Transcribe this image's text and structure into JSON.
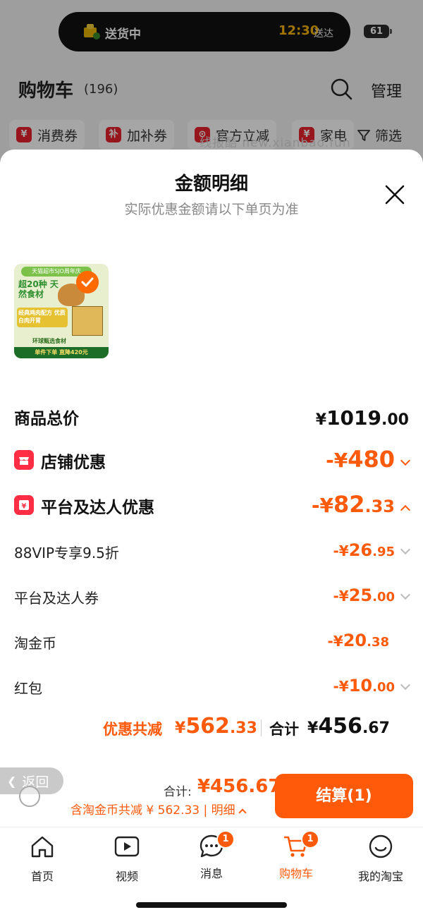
{
  "status": {
    "island_text": "送货中",
    "time": "12:30",
    "time_suffix": "送达",
    "battery": "61"
  },
  "cart": {
    "title": "购物车",
    "count": "(196)",
    "manage": "管理"
  },
  "chips": [
    {
      "icon": "¥",
      "label": "消费券"
    },
    {
      "icon": "补",
      "label": "加补券"
    },
    {
      "icon": "⊙",
      "label": "官方立减"
    },
    {
      "icon": "¥",
      "label": "家电"
    }
  ],
  "filter_label": "筛选",
  "watermark": "线报酷 new.xianbao.fun",
  "sheet": {
    "title": "金额明细",
    "subtitle": "实际优惠金额请以下单页为准"
  },
  "product": {
    "banner": "天猫超市SJO周年庆",
    "headline": "超20种 天然食材",
    "promo": "经典鸡肉配方 优质白肉开胃",
    "tag": "环球甄选食材",
    "footer": "单件下单 直降420元"
  },
  "rows": {
    "total": {
      "label": "商品总价",
      "yen": "¥",
      "int": "1019",
      "dec": ".00"
    },
    "store": {
      "label": "店铺优惠",
      "prefix": "-¥",
      "int": "480",
      "dec": ""
    },
    "platform": {
      "label": "平台及达人优惠",
      "prefix": "-¥",
      "int": "82",
      "dec": ".33"
    },
    "vip": {
      "label": "88VIP专享9.5折",
      "prefix": "-¥",
      "int": "26",
      "dec": ".95"
    },
    "coupon": {
      "label": "平台及达人券",
      "prefix": "-¥",
      "int": "25",
      "dec": ".00"
    },
    "coin": {
      "label": "淘金币",
      "prefix": "-¥",
      "int": "20",
      "dec": ".38"
    },
    "redpacket": {
      "label": "红包",
      "prefix": "-¥",
      "int": "10",
      "dec": ".00"
    }
  },
  "summary": {
    "discount_label": "优惠共减",
    "discount_yen": "¥",
    "discount_int": "562",
    "discount_dec": ".33",
    "sum_label": "合计",
    "sum_yen": "¥",
    "sum_int": "456",
    "sum_dec": ".67"
  },
  "bottom": {
    "back": "返回",
    "total_label": "合计:",
    "total_value": "¥456.67",
    "detail": "含淘金币共减 ¥ 562.33 | 明细",
    "checkout": "结算(1)"
  },
  "tabs": [
    {
      "label": "首页",
      "badge": ""
    },
    {
      "label": "视频",
      "badge": ""
    },
    {
      "label": "消息",
      "badge": "1"
    },
    {
      "label": "购物车",
      "badge": "1"
    },
    {
      "label": "我的淘宝",
      "badge": ""
    }
  ],
  "colors": {
    "accent": "#ff5a0a",
    "red_icon": "#ff2e44"
  }
}
